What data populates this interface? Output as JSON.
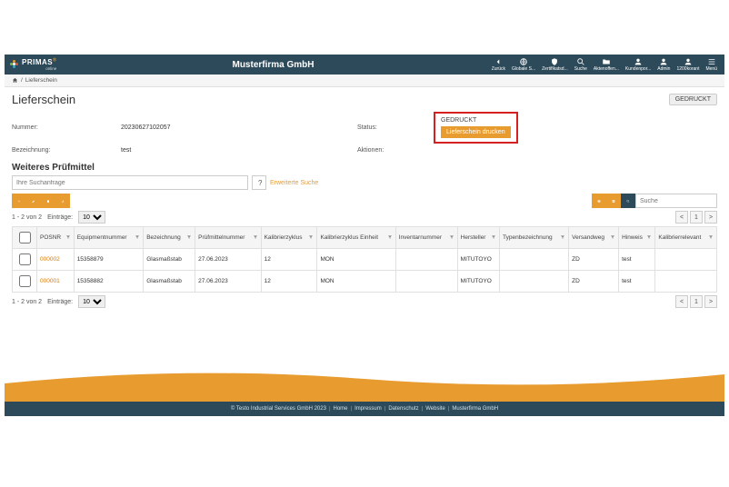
{
  "brand": {
    "name": "PRIMAS",
    "sub": "online"
  },
  "company": "Musterfirma GmbH",
  "nav": [
    {
      "id": "back",
      "label": "Zurück"
    },
    {
      "id": "global",
      "label": "Globale S..."
    },
    {
      "id": "cert",
      "label": "Zertifikatsd..."
    },
    {
      "id": "search",
      "label": "Suche"
    },
    {
      "id": "files",
      "label": "Aktenoffen..."
    },
    {
      "id": "cust",
      "label": "Kundenpor..."
    },
    {
      "id": "admin",
      "label": "Admin"
    },
    {
      "id": "user",
      "label": "1200korant"
    },
    {
      "id": "menu",
      "label": "Menü"
    }
  ],
  "breadcrumb": {
    "home_icon": "home",
    "sep": "/",
    "current": "Lieferschein"
  },
  "page": {
    "title": "Lieferschein",
    "badge": "GEDRUCKT",
    "fields": {
      "nummer_label": "Nummer:",
      "nummer_value": "20230627102057",
      "bez_label": "Bezeichnung:",
      "bez_value": "test",
      "status_label": "Status:",
      "status_value": "GEDRUCKT",
      "aktionen_label": "Aktionen:",
      "print_btn": "Lieferschein drucken"
    }
  },
  "section": {
    "title": "Weiteres Prüfmittel",
    "search_placeholder": "Ihre Suchanfrage",
    "help": "?",
    "adv_link": "Erweiterte Suche",
    "quick_search_placeholder": "Suche"
  },
  "pager": {
    "info": "1 - 2 von 2",
    "entries_label": "Einträge:",
    "entries_value": "10",
    "page_current": "1"
  },
  "table": {
    "headers": [
      "",
      "POSNR",
      "Equipmentnummer",
      "Bezeichnung",
      "Prüfmittelnummer",
      "Kalibrierzyklus",
      "Kalibrierzyklus Einheit",
      "Inventarnummer",
      "Hersteller",
      "Typenbezeichnung",
      "Versandweg",
      "Hinweis",
      "Kalibrierrelevant"
    ],
    "rows": [
      {
        "posnr": "000002",
        "equip": "15358879",
        "bez": "Glasmaßstab",
        "pmnr": "27.06.2023",
        "zyklus": "12",
        "einheit": "MON",
        "inv": "",
        "herst": "MITUTOYO",
        "typ": "",
        "versand": "ZD",
        "hinweis": "test",
        "kalrel": ""
      },
      {
        "posnr": "000001",
        "equip": "15358882",
        "bez": "Glasmaßstab",
        "pmnr": "27.06.2023",
        "zyklus": "12",
        "einheit": "MON",
        "inv": "",
        "herst": "MITUTOYO",
        "typ": "",
        "versand": "ZD",
        "hinweis": "test",
        "kalrel": ""
      }
    ]
  },
  "footer": {
    "copyright": "© Testo Industrial Services GmbH 2023",
    "links": [
      "Home",
      "Impressum",
      "Datenschutz",
      "Website",
      "Musterfirma GmbH"
    ]
  }
}
